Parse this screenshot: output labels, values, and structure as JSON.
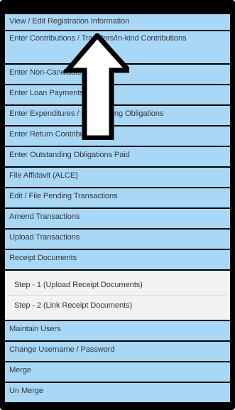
{
  "menu": {
    "items": [
      {
        "label": "View / Edit Registration Information"
      },
      {
        "label": "Enter Contributions / Transfers/In-kind Contributions"
      },
      {
        "label": "Enter Non-Candidate Loans"
      },
      {
        "label": "Enter Loan Payments"
      },
      {
        "label": "Enter Expenditures / Outstanding Obligations"
      },
      {
        "label": "Enter Return Contributions"
      },
      {
        "label": "Enter Outstanding Obligations Paid"
      },
      {
        "label": "File Affidavit (ALCE)"
      },
      {
        "label": "Edit / File Pending Transactions"
      },
      {
        "label": "Amend Transactions"
      },
      {
        "label": "Upload Transactions"
      },
      {
        "label": "Receipt Documents"
      },
      {
        "label": "Maintain Users"
      },
      {
        "label": "Change Username / Password"
      },
      {
        "label": "Merge"
      },
      {
        "label": "Un Merge"
      }
    ],
    "receipt_subitems": [
      {
        "label": "Step - 1 (Upload Receipt Documents)"
      },
      {
        "label": "Step - 2 (Link Receipt Documents)"
      }
    ]
  },
  "annotation": {
    "icon": "up-arrow-icon",
    "color": "#000000",
    "fill": "#ffffff"
  },
  "colors": {
    "item_bg": "#a9d8f7",
    "subitem_bg": "#f2f2f2",
    "text": "#333a44",
    "frame": "#000000"
  }
}
